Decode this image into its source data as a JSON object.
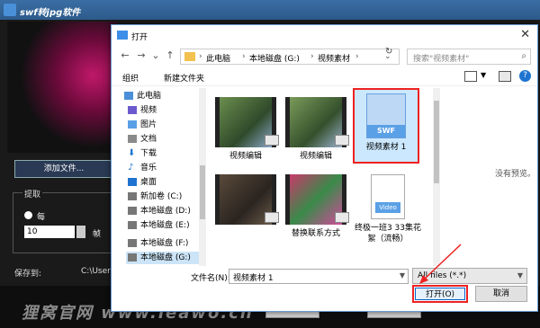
{
  "app": {
    "title": "swf转jpg软件",
    "add_file": "添加文件...",
    "extract_label": "提取",
    "every": "每",
    "interval_value": "10",
    "unit": "帧",
    "save_to": "保存到:",
    "save_path": "C:\\Users\\",
    "btn1": "...",
    "btn2": "...",
    "watermark": "狸窝官网  www.leawo.cn"
  },
  "dialog": {
    "title": "打开",
    "breadcrumb": [
      "此电脑",
      "本地磁盘 (G:)",
      "视频素材"
    ],
    "search_placeholder": "搜索\"视频素材\"",
    "toolbar": {
      "organize": "组织",
      "new_folder": "新建文件夹"
    },
    "tree": [
      "此电脑",
      "视频",
      "图片",
      "文档",
      "下载",
      "音乐",
      "桌面",
      "新加卷 (C:)",
      "本地磁盘 (D:)",
      "本地磁盘 (E:)",
      "本地磁盘 (F:)",
      "本地磁盘 (G:)"
    ],
    "files": [
      {
        "label": "视频编辑"
      },
      {
        "label": "视频编辑"
      },
      {
        "label": "视频素材 1",
        "type": "SWF"
      },
      {
        "label": ""
      },
      {
        "label": "替换联系方式"
      },
      {
        "label": "终极一班3 33集花絮（流畅）",
        "type": "Video"
      }
    ],
    "no_preview": "没有预览。",
    "filename_label": "文件名(N):",
    "filename_value": "视频素材 1",
    "filter": "All files (*.*)",
    "open": "打开(O)",
    "cancel": "取消"
  },
  "colors": {
    "highlight": "#e22222",
    "accent": "#1e73d0"
  }
}
